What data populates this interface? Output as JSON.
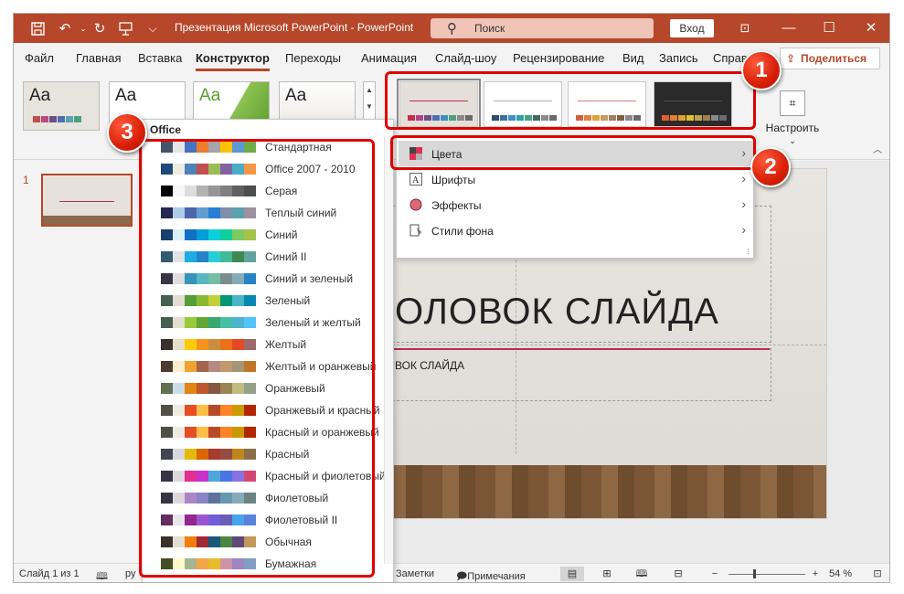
{
  "window": {
    "title": "Презентация Microsoft PowerPoint  -  PowerPoint",
    "search_placeholder": "Поиск",
    "login_label": "Вход",
    "accent_color": "#b7472a"
  },
  "tabs": [
    "Файл",
    "Главная",
    "Вставка",
    "Конструктор",
    "Переходы",
    "Анимация",
    "Слайд-шоу",
    "Рецензирование",
    "Вид",
    "Запись",
    "Справ"
  ],
  "active_tab": "Конструктор",
  "share_label": "Поделиться",
  "ribbon": {
    "theme_thumb_text": "Aa",
    "customize_label": "Настроить"
  },
  "slide_panel": {
    "slide_number": "1"
  },
  "slide": {
    "title_text": "ОЛОВОК СЛАЙДА",
    "subtitle_text": "ВОК СЛАЙДА"
  },
  "variant_menu": [
    {
      "label": "Цвета",
      "icon": "colors-icon",
      "highlighted": true
    },
    {
      "label": "Шрифты",
      "icon": "fonts-icon",
      "highlighted": false
    },
    {
      "label": "Эффекты",
      "icon": "effects-icon",
      "highlighted": false
    },
    {
      "label": "Стили фона",
      "icon": "background-styles-icon",
      "highlighted": false
    }
  ],
  "colors_dropdown": {
    "header": "Office",
    "schemes": [
      {
        "label": "Стандартная",
        "colors": [
          "#44546a",
          "#e7e6e6",
          "#4472c4",
          "#ed7d31",
          "#a5a5a5",
          "#ffc000",
          "#5b9bd5",
          "#70ad47"
        ]
      },
      {
        "label": "Office 2007 - 2010",
        "colors": [
          "#1f497d",
          "#eeece1",
          "#4f81bd",
          "#c0504d",
          "#9bbb59",
          "#8064a2",
          "#4bacc6",
          "#f79646"
        ]
      },
      {
        "label": "Серая",
        "colors": [
          "#000000",
          "#f8f8f8",
          "#dddddd",
          "#b2b2b2",
          "#969696",
          "#808080",
          "#5f5f5f",
          "#4d4d4d"
        ]
      },
      {
        "label": "Теплый синий",
        "colors": [
          "#242852",
          "#acccea",
          "#4a66ac",
          "#629dd1",
          "#297fd5",
          "#7f8fa9",
          "#5aa2ae",
          "#9d90a0"
        ]
      },
      {
        "label": "Синий",
        "colors": [
          "#17406d",
          "#dbeff9",
          "#0f6fc6",
          "#009dd9",
          "#0bd0d9",
          "#10cf9b",
          "#7cca62",
          "#a5c249"
        ]
      },
      {
        "label": "Синий II",
        "colors": [
          "#335b74",
          "#dfe3e5",
          "#1cade4",
          "#2683c6",
          "#27ced7",
          "#42ba97",
          "#3e8853",
          "#62a39f"
        ]
      },
      {
        "label": "Синий и зеленый",
        "colors": [
          "#373545",
          "#dedede",
          "#3494ba",
          "#58b6c0",
          "#75bda7",
          "#7a8c8e",
          "#84acb6",
          "#2683c6"
        ]
      },
      {
        "label": "Зеленый",
        "colors": [
          "#455f51",
          "#e3ded1",
          "#549e39",
          "#8ab833",
          "#c0cf3a",
          "#029676",
          "#4ab5c4",
          "#0989b1"
        ]
      },
      {
        "label": "Зеленый и желтый",
        "colors": [
          "#455f51",
          "#e3ded1",
          "#99cb38",
          "#63a537",
          "#37a76f",
          "#44c1a3",
          "#4eb3cf",
          "#51c3f9"
        ]
      },
      {
        "label": "Желтый",
        "colors": [
          "#39302a",
          "#e5dec9",
          "#ffca08",
          "#f8931d",
          "#ce8d3e",
          "#ec7016",
          "#e64823",
          "#9c6a6a"
        ]
      },
      {
        "label": "Желтый и оранжевый",
        "colors": [
          "#4e3b30",
          "#fbeec9",
          "#f0a22e",
          "#a5644e",
          "#b58b80",
          "#c3986d",
          "#a19574",
          "#c17529"
        ]
      },
      {
        "label": "Оранжевый",
        "colors": [
          "#637052",
          "#ccddea",
          "#e48312",
          "#bd582c",
          "#865640",
          "#9b8357",
          "#c2bc80",
          "#94a088"
        ]
      },
      {
        "label": "Оранжевый и красный",
        "colors": [
          "#505046",
          "#eeece1",
          "#e84c22",
          "#ffbd47",
          "#b64926",
          "#ff8427",
          "#cc9900",
          "#b22600"
        ]
      },
      {
        "label": "Красный и оранжевый",
        "colors": [
          "#505046",
          "#eeece1",
          "#e84c22",
          "#ffbd47",
          "#b64926",
          "#ff8427",
          "#cc9900",
          "#b22600"
        ]
      },
      {
        "label": "Красный",
        "colors": [
          "#454551",
          "#d8d9dc",
          "#e3ba0b",
          "#dc6500",
          "#a63b2e",
          "#954d41",
          "#c0851c",
          "#8a6e4a"
        ]
      },
      {
        "label": "Красный и фиолетовый",
        "colors": [
          "#373545",
          "#dcd8dc",
          "#e32d91",
          "#c830cc",
          "#4ea6dc",
          "#4775e7",
          "#8971e1",
          "#d54773"
        ]
      },
      {
        "label": "Фиолетовый",
        "colors": [
          "#373545",
          "#dcd8dc",
          "#ad84c6",
          "#8784c7",
          "#5d739a",
          "#6997af",
          "#84acb6",
          "#6f8183"
        ]
      },
      {
        "label": "Фиолетовый II",
        "colors": [
          "#632e62",
          "#eae5eb",
          "#92278f",
          "#9b57d3",
          "#755dd9",
          "#665eb8",
          "#45a5ed",
          "#5982db"
        ]
      },
      {
        "label": "Обычная",
        "colors": [
          "#39302a",
          "#e4ded1",
          "#f07f09",
          "#9f2936",
          "#1b587c",
          "#4e8542",
          "#604878",
          "#c19859"
        ]
      },
      {
        "label": "Бумажная",
        "colors": [
          "#444d26",
          "#fefac9",
          "#a5b592",
          "#f3a447",
          "#e7bc29",
          "#d092a7",
          "#9c85c0",
          "#809ec2"
        ]
      }
    ]
  },
  "themes": [
    {
      "colors": [
        "#c0504d",
        "#b84b7a",
        "#6a4e8a",
        "#4f6fb0",
        "#5aa0b8",
        "#4aa080"
      ]
    },
    {
      "colors": []
    },
    {
      "colors": []
    },
    {
      "colors": []
    }
  ],
  "variants": [
    {
      "bg": "#e4dfd8",
      "line": "#c0304a",
      "colors": [
        "#c0304a",
        "#b8408a",
        "#6a4e8a",
        "#4f6fb0",
        "#3f8fc0",
        "#4aa080",
        "#8a8a8a",
        "#6a6a6a"
      ],
      "selected": true
    },
    {
      "bg": "#ffffff",
      "line": "#b0b0b0",
      "colors": [
        "#2f4f6f",
        "#3f6f9f",
        "#3f8fc0",
        "#2fa0a0",
        "#4aa080",
        "#3f6f5f",
        "#8a8a8a",
        "#6a6a6a"
      ],
      "selected": false
    },
    {
      "bg": "#ffffff",
      "line": "#d08080",
      "colors": [
        "#d06040",
        "#e08040",
        "#e0a040",
        "#c0a060",
        "#a08060",
        "#806040",
        "#8a8a8a",
        "#6a6a6a"
      ],
      "selected": false
    },
    {
      "bg": "#2a2a2a",
      "line": "#505050",
      "colors": [
        "#e06030",
        "#e08030",
        "#e0a030",
        "#e0c030",
        "#c0a050",
        "#a08050",
        "#8a8a8a",
        "#6a6a6a"
      ],
      "selected": false
    }
  ],
  "status": {
    "slide_info": "Слайд 1 из 1",
    "lang_fragment": "ру",
    "notes": "Заметки",
    "comments": "Примечания",
    "zoom": "54 %",
    "zoom_fraction": 0.33
  },
  "annotations": [
    "1",
    "2",
    "3"
  ]
}
